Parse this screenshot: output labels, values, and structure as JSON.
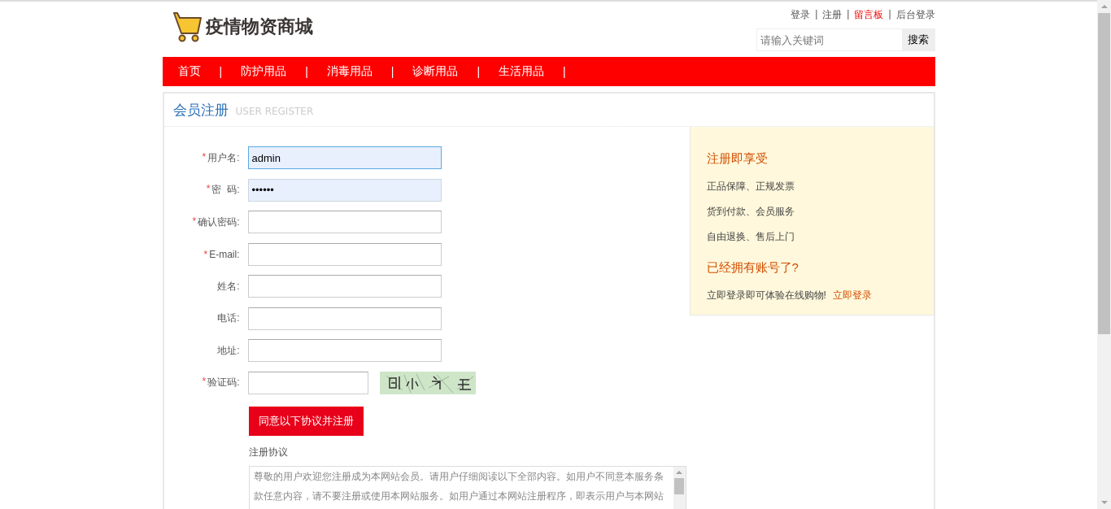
{
  "header": {
    "logo_text": "疫情物资商城",
    "top_links": [
      {
        "label": "登录",
        "highlighted": false,
        "separator": "|"
      },
      {
        "label": "注册",
        "highlighted": false,
        "separator": "|"
      },
      {
        "label": "留言板",
        "highlighted": true,
        "separator": "|"
      },
      {
        "label": "后台登录",
        "highlighted": false
      }
    ],
    "search": {
      "placeholder": "请输入关键词",
      "button": "搜索"
    }
  },
  "nav": [
    {
      "label": "首页",
      "separator": "|"
    },
    {
      "label": "防护用品",
      "separator": "|"
    },
    {
      "label": "消毒用品",
      "separator": "|"
    },
    {
      "label": "诊断用品",
      "separator": "|"
    },
    {
      "label": "生活用品",
      "separator": "|"
    }
  ],
  "panel": {
    "title": "会员注册",
    "subtitle": "USER REGISTER"
  },
  "form": {
    "fields": [
      {
        "required_mark": "*",
        "label": "用户名:",
        "kind": "text",
        "value": "admin",
        "autofilled": true
      },
      {
        "required_mark": "*",
        "label": "密  码:",
        "kind": "password",
        "value": "••••••",
        "autofilled": true
      },
      {
        "required_mark": "*",
        "label": "确认密码:",
        "kind": "password",
        "autofilled": false
      },
      {
        "required_mark": "*",
        "label": "E-mail:",
        "kind": "text",
        "autofilled": false
      },
      {
        "label": "姓名:",
        "kind": "text",
        "autofilled": false
      },
      {
        "label": "电话:",
        "kind": "text",
        "autofilled": false
      },
      {
        "label": "地址:",
        "kind": "text",
        "autofilled": false
      },
      {
        "required_mark": "*",
        "label": "验证码:",
        "kind": "captcha",
        "autofilled": false
      }
    ],
    "submit": "同意以下协议并注册",
    "agreement_title": "注册协议",
    "agreement_text": "尊敬的用户欢迎您注册成为本网站会员。请用户仔细阅读以下全部内容。如用户不同意本服务条款任意内容，请不要注册或使用本网站服务。如用户通过本网站注册程序，即表示用户与本网站"
  },
  "sidebar": {
    "title": "注册即享受",
    "benefits": [
      "正品保障、正规发票",
      "货到付款、会员服务",
      "自由退换、售后上门"
    ],
    "login_title": "已经拥有账号了?",
    "login_text": "立即登录即可体验在线购物!",
    "login_link": "立即登录"
  }
}
